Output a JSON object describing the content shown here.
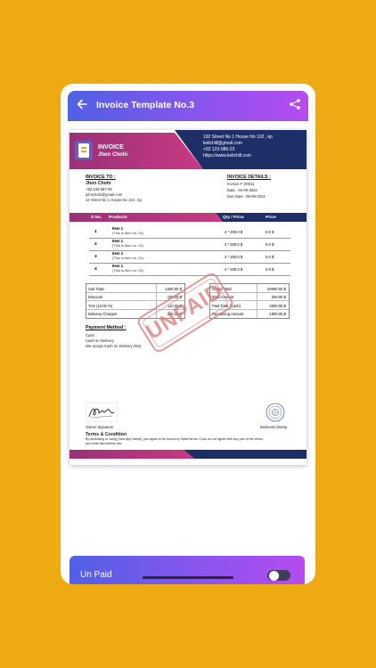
{
  "app": {
    "title": "Invoice Template No.3"
  },
  "invoice": {
    "heading": "INVOICE",
    "name": "Jhon Chohi",
    "contact": [
      "192 Street No 1 House No 102 , kp",
      "kellchill@gmail.com",
      "+92 123-980-23",
      "https://www.kellchill.com"
    ],
    "to_title": "INVOICE TO :",
    "to_name": "Jhon Chohi",
    "to_lines": [
      "+92 234-987-09",
      "johnchohi@gmail.com",
      "12 Street No 1 House No 134 , kp"
    ],
    "details_title": "INVOICE DETAILS :",
    "details_lines": [
      "Invoice # :00011",
      "Date : 04-09-2024",
      "Due Date : 09-09-2024"
    ],
    "table_headers": {
      "sno": "S No.",
      "products": "Products",
      "qty_price": "Qty / Price",
      "price": "Price"
    },
    "items": [
      {
        "sn": "1",
        "name": "Item 1",
        "desc": "(This is item no. 01)",
        "qty_price": "4 * 200.0 $",
        "price": "0.0 $"
      },
      {
        "sn": "2",
        "name": "Item 1",
        "desc": "(This is item no. 01)",
        "qty_price": "4 * 200.0 $",
        "price": "0.0 $"
      },
      {
        "sn": "3",
        "name": "Item 1",
        "desc": "(This is item no. 01)",
        "qty_price": "4 * 200.0 $",
        "price": "0.0 $"
      },
      {
        "sn": "4",
        "name": "Item 1",
        "desc": "(This is item no. 01)",
        "qty_price": "4 * 200.0 $",
        "price": "0.0 $"
      }
    ],
    "summary_left": [
      {
        "k": "Sub Total",
        "v": "1200.00 $"
      },
      {
        "k": "Discount",
        "v": "100.00 $"
      },
      {
        "k": "TAX (10.00 %)",
        "v": "110.00 $"
      },
      {
        "k": "Delivery Charges",
        "v": "200.00 $"
      }
    ],
    "summary_right": [
      {
        "k": "Grand Total",
        "v": "20000.00 $"
      },
      {
        "k": "Total Amount",
        "v": "200.00 $"
      },
      {
        "k": "Paid Total (Cash)",
        "v": "2000.00 $"
      },
      {
        "k": "Remaining Amount",
        "v": "-1800.00 $"
      }
    ],
    "stamp": "UNPAID",
    "payment_title": "Payment Method :",
    "payment_lines": [
      "Cash",
      "Cash on Delivery",
      "We accept Cash on Delivery Only"
    ],
    "owner_signature": "Owner Signature",
    "business_stamp": "Business Stamp",
    "terms_title": "Terms & Condition",
    "terms_line1": "By accessing or using [Your App Name], you agree to be bound by these terms. If you do not agree with any part of the terms,",
    "terms_line2": "you must discontinue use."
  },
  "bottom": {
    "status_label": "Un Paid",
    "toggle_on": false
  },
  "colors": {
    "background": "#EEAA12",
    "accent_pink": "#C73A82",
    "accent_navy": "#1E2E66",
    "appbar": "#8A55EE"
  },
  "icons": {
    "back": "back-arrow-icon",
    "share": "share-icon",
    "logo": "invoice-logo-icon"
  }
}
